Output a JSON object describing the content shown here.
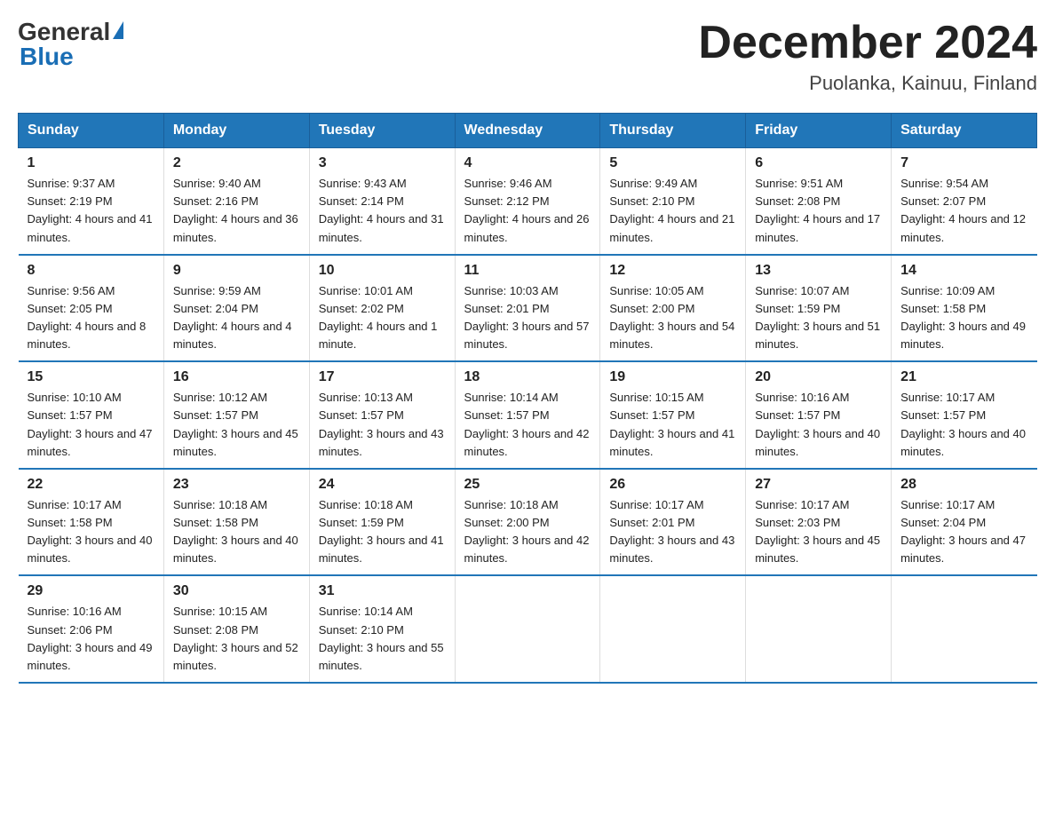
{
  "header": {
    "logo_general": "General",
    "logo_blue": "Blue",
    "month_title": "December 2024",
    "location": "Puolanka, Kainuu, Finland"
  },
  "weekdays": [
    "Sunday",
    "Monday",
    "Tuesday",
    "Wednesday",
    "Thursday",
    "Friday",
    "Saturday"
  ],
  "weeks": [
    [
      {
        "day": "1",
        "sunrise": "Sunrise: 9:37 AM",
        "sunset": "Sunset: 2:19 PM",
        "daylight": "Daylight: 4 hours and 41 minutes."
      },
      {
        "day": "2",
        "sunrise": "Sunrise: 9:40 AM",
        "sunset": "Sunset: 2:16 PM",
        "daylight": "Daylight: 4 hours and 36 minutes."
      },
      {
        "day": "3",
        "sunrise": "Sunrise: 9:43 AM",
        "sunset": "Sunset: 2:14 PM",
        "daylight": "Daylight: 4 hours and 31 minutes."
      },
      {
        "day": "4",
        "sunrise": "Sunrise: 9:46 AM",
        "sunset": "Sunset: 2:12 PM",
        "daylight": "Daylight: 4 hours and 26 minutes."
      },
      {
        "day": "5",
        "sunrise": "Sunrise: 9:49 AM",
        "sunset": "Sunset: 2:10 PM",
        "daylight": "Daylight: 4 hours and 21 minutes."
      },
      {
        "day": "6",
        "sunrise": "Sunrise: 9:51 AM",
        "sunset": "Sunset: 2:08 PM",
        "daylight": "Daylight: 4 hours and 17 minutes."
      },
      {
        "day": "7",
        "sunrise": "Sunrise: 9:54 AM",
        "sunset": "Sunset: 2:07 PM",
        "daylight": "Daylight: 4 hours and 12 minutes."
      }
    ],
    [
      {
        "day": "8",
        "sunrise": "Sunrise: 9:56 AM",
        "sunset": "Sunset: 2:05 PM",
        "daylight": "Daylight: 4 hours and 8 minutes."
      },
      {
        "day": "9",
        "sunrise": "Sunrise: 9:59 AM",
        "sunset": "Sunset: 2:04 PM",
        "daylight": "Daylight: 4 hours and 4 minutes."
      },
      {
        "day": "10",
        "sunrise": "Sunrise: 10:01 AM",
        "sunset": "Sunset: 2:02 PM",
        "daylight": "Daylight: 4 hours and 1 minute."
      },
      {
        "day": "11",
        "sunrise": "Sunrise: 10:03 AM",
        "sunset": "Sunset: 2:01 PM",
        "daylight": "Daylight: 3 hours and 57 minutes."
      },
      {
        "day": "12",
        "sunrise": "Sunrise: 10:05 AM",
        "sunset": "Sunset: 2:00 PM",
        "daylight": "Daylight: 3 hours and 54 minutes."
      },
      {
        "day": "13",
        "sunrise": "Sunrise: 10:07 AM",
        "sunset": "Sunset: 1:59 PM",
        "daylight": "Daylight: 3 hours and 51 minutes."
      },
      {
        "day": "14",
        "sunrise": "Sunrise: 10:09 AM",
        "sunset": "Sunset: 1:58 PM",
        "daylight": "Daylight: 3 hours and 49 minutes."
      }
    ],
    [
      {
        "day": "15",
        "sunrise": "Sunrise: 10:10 AM",
        "sunset": "Sunset: 1:57 PM",
        "daylight": "Daylight: 3 hours and 47 minutes."
      },
      {
        "day": "16",
        "sunrise": "Sunrise: 10:12 AM",
        "sunset": "Sunset: 1:57 PM",
        "daylight": "Daylight: 3 hours and 45 minutes."
      },
      {
        "day": "17",
        "sunrise": "Sunrise: 10:13 AM",
        "sunset": "Sunset: 1:57 PM",
        "daylight": "Daylight: 3 hours and 43 minutes."
      },
      {
        "day": "18",
        "sunrise": "Sunrise: 10:14 AM",
        "sunset": "Sunset: 1:57 PM",
        "daylight": "Daylight: 3 hours and 42 minutes."
      },
      {
        "day": "19",
        "sunrise": "Sunrise: 10:15 AM",
        "sunset": "Sunset: 1:57 PM",
        "daylight": "Daylight: 3 hours and 41 minutes."
      },
      {
        "day": "20",
        "sunrise": "Sunrise: 10:16 AM",
        "sunset": "Sunset: 1:57 PM",
        "daylight": "Daylight: 3 hours and 40 minutes."
      },
      {
        "day": "21",
        "sunrise": "Sunrise: 10:17 AM",
        "sunset": "Sunset: 1:57 PM",
        "daylight": "Daylight: 3 hours and 40 minutes."
      }
    ],
    [
      {
        "day": "22",
        "sunrise": "Sunrise: 10:17 AM",
        "sunset": "Sunset: 1:58 PM",
        "daylight": "Daylight: 3 hours and 40 minutes."
      },
      {
        "day": "23",
        "sunrise": "Sunrise: 10:18 AM",
        "sunset": "Sunset: 1:58 PM",
        "daylight": "Daylight: 3 hours and 40 minutes."
      },
      {
        "day": "24",
        "sunrise": "Sunrise: 10:18 AM",
        "sunset": "Sunset: 1:59 PM",
        "daylight": "Daylight: 3 hours and 41 minutes."
      },
      {
        "day": "25",
        "sunrise": "Sunrise: 10:18 AM",
        "sunset": "Sunset: 2:00 PM",
        "daylight": "Daylight: 3 hours and 42 minutes."
      },
      {
        "day": "26",
        "sunrise": "Sunrise: 10:17 AM",
        "sunset": "Sunset: 2:01 PM",
        "daylight": "Daylight: 3 hours and 43 minutes."
      },
      {
        "day": "27",
        "sunrise": "Sunrise: 10:17 AM",
        "sunset": "Sunset: 2:03 PM",
        "daylight": "Daylight: 3 hours and 45 minutes."
      },
      {
        "day": "28",
        "sunrise": "Sunrise: 10:17 AM",
        "sunset": "Sunset: 2:04 PM",
        "daylight": "Daylight: 3 hours and 47 minutes."
      }
    ],
    [
      {
        "day": "29",
        "sunrise": "Sunrise: 10:16 AM",
        "sunset": "Sunset: 2:06 PM",
        "daylight": "Daylight: 3 hours and 49 minutes."
      },
      {
        "day": "30",
        "sunrise": "Sunrise: 10:15 AM",
        "sunset": "Sunset: 2:08 PM",
        "daylight": "Daylight: 3 hours and 52 minutes."
      },
      {
        "day": "31",
        "sunrise": "Sunrise: 10:14 AM",
        "sunset": "Sunset: 2:10 PM",
        "daylight": "Daylight: 3 hours and 55 minutes."
      },
      {
        "day": "",
        "sunrise": "",
        "sunset": "",
        "daylight": ""
      },
      {
        "day": "",
        "sunrise": "",
        "sunset": "",
        "daylight": ""
      },
      {
        "day": "",
        "sunrise": "",
        "sunset": "",
        "daylight": ""
      },
      {
        "day": "",
        "sunrise": "",
        "sunset": "",
        "daylight": ""
      }
    ]
  ]
}
